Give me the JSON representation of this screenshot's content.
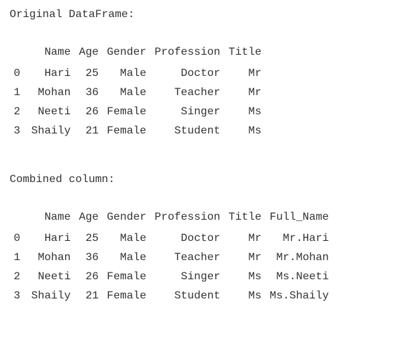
{
  "section1": {
    "title": "Original DataFrame:",
    "columns": [
      "",
      "Name",
      "Age",
      "Gender",
      "Profession",
      "Title"
    ],
    "rows": [
      {
        "idx": "0",
        "Name": "Hari",
        "Age": "25",
        "Gender": "Male",
        "Profession": "Doctor",
        "Title": "Mr"
      },
      {
        "idx": "1",
        "Name": "Mohan",
        "Age": "36",
        "Gender": "Male",
        "Profession": "Teacher",
        "Title": "Mr"
      },
      {
        "idx": "2",
        "Name": "Neeti",
        "Age": "26",
        "Gender": "Female",
        "Profession": "Singer",
        "Title": "Ms"
      },
      {
        "idx": "3",
        "Name": "Shaily",
        "Age": "21",
        "Gender": "Female",
        "Profession": "Student",
        "Title": "Ms"
      }
    ]
  },
  "section2": {
    "title": "Combined column:",
    "columns": [
      "",
      "Name",
      "Age",
      "Gender",
      "Profession",
      "Title",
      "Full_Name"
    ],
    "rows": [
      {
        "idx": "0",
        "Name": "Hari",
        "Age": "25",
        "Gender": "Male",
        "Profession": "Doctor",
        "Title": "Mr",
        "Full_Name": "Mr.Hari"
      },
      {
        "idx": "1",
        "Name": "Mohan",
        "Age": "36",
        "Gender": "Male",
        "Profession": "Teacher",
        "Title": "Mr",
        "Full_Name": "Mr.Mohan"
      },
      {
        "idx": "2",
        "Name": "Neeti",
        "Age": "26",
        "Gender": "Female",
        "Profession": "Singer",
        "Title": "Ms",
        "Full_Name": "Ms.Neeti"
      },
      {
        "idx": "3",
        "Name": "Shaily",
        "Age": "21",
        "Gender": "Female",
        "Profession": "Student",
        "Title": "Ms",
        "Full_Name": "Ms.Shaily"
      }
    ]
  }
}
